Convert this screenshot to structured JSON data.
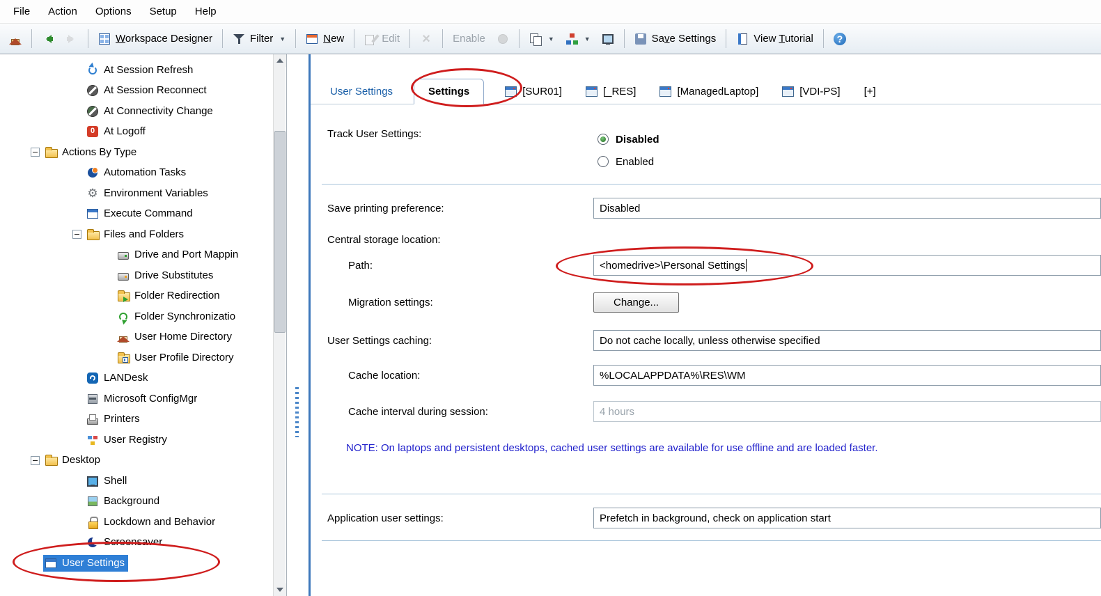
{
  "menu": {
    "items": [
      {
        "label": "File"
      },
      {
        "label": "Action"
      },
      {
        "label": "Options"
      },
      {
        "label": "Setup"
      },
      {
        "label": "Help"
      }
    ]
  },
  "toolbar": {
    "workspace_designer": {
      "pre": "",
      "accel": "W",
      "post": "orkspace Designer"
    },
    "filter_label": "Filter",
    "new": {
      "pre": "",
      "accel": "N",
      "post": "ew"
    },
    "edit_label": "Edit",
    "enable_label": "Enable",
    "save_settings": {
      "pre": "Sa",
      "accel": "v",
      "post": "e Settings"
    },
    "view_tutorial": {
      "pre": "View ",
      "accel": "T",
      "post": "utorial"
    }
  },
  "icons": {
    "toolbar": [
      "home-icon",
      "back-icon",
      "forward-icon",
      "workspace-designer-icon",
      "filter-icon",
      "new-icon",
      "edit-icon",
      "delete-icon",
      "enable-icon",
      "copy-icon",
      "org-chart-icon",
      "monitor-icon",
      "save-icon",
      "tutorial-book-icon",
      "help-icon"
    ],
    "tree_expander": "minus-box",
    "tab_icon": "window-thumbnail"
  },
  "tree": {
    "items": [
      {
        "label": "At Session Refresh",
        "icon": "session-refresh-icon"
      },
      {
        "label": "At Session Reconnect",
        "icon": "session-reconnect-icon"
      },
      {
        "label": "At Connectivity Change",
        "icon": "connectivity-change-icon"
      },
      {
        "label": "At Logoff",
        "icon": "logoff-icon"
      },
      {
        "label": "Actions By Type",
        "icon": "folder-icon"
      },
      {
        "label": "Automation Tasks",
        "icon": "automation-tasks-icon"
      },
      {
        "label": "Environment Variables",
        "icon": "environment-variables-icon"
      },
      {
        "label": "Execute Command",
        "icon": "execute-command-icon"
      },
      {
        "label": "Files and Folders",
        "icon": "folder-icon"
      },
      {
        "label": "Drive and Port Mappin",
        "icon": "drive-mapping-icon"
      },
      {
        "label": "Drive Substitutes",
        "icon": "drive-substitutes-icon"
      },
      {
        "label": "Folder Redirection",
        "icon": "folder-redirection-icon"
      },
      {
        "label": "Folder Synchronizatio",
        "icon": "folder-synchronization-icon"
      },
      {
        "label": "User Home Directory",
        "icon": "home-directory-icon"
      },
      {
        "label": "User Profile Directory",
        "icon": "profile-directory-icon"
      },
      {
        "label": "LANDesk",
        "icon": "landesk-icon"
      },
      {
        "label": "Microsoft ConfigMgr",
        "icon": "configmgr-icon"
      },
      {
        "label": "Printers",
        "icon": "printer-icon"
      },
      {
        "label": "User Registry",
        "icon": "registry-icon"
      },
      {
        "label": "Desktop",
        "icon": "folder-icon"
      },
      {
        "label": "Shell",
        "icon": "shell-icon"
      },
      {
        "label": "Background",
        "icon": "background-icon"
      },
      {
        "label": "Lockdown and Behavior",
        "icon": "lock-icon"
      },
      {
        "label": "Screensaver",
        "icon": "screensaver-icon"
      },
      {
        "label": "User Settings",
        "icon": "user-settings-icon",
        "selected": true
      }
    ]
  },
  "tabs": {
    "items": [
      {
        "label": "User Settings"
      },
      {
        "label": "Settings",
        "active": true
      },
      {
        "label": "[SUR01]"
      },
      {
        "label": "[_RES]"
      },
      {
        "label": "[ManagedLaptop]"
      },
      {
        "label": "[VDI-PS]"
      },
      {
        "label": "[+]"
      }
    ]
  },
  "form": {
    "track_user_settings": {
      "label": "Track User Settings:",
      "options": [
        {
          "label": "Disabled",
          "selected": true
        },
        {
          "label": "Enabled",
          "selected": false
        }
      ]
    },
    "save_printing_preference": {
      "label": "Save printing preference:",
      "value": "Disabled"
    },
    "central_storage_location_label": "Central storage location:",
    "path": {
      "label": "Path:",
      "value": "<homedrive>\\Personal Settings"
    },
    "migration_settings": {
      "label": "Migration settings:",
      "button_label": "Change..."
    },
    "user_settings_caching": {
      "label": "User Settings caching:",
      "value": "Do not cache locally, unless otherwise specified"
    },
    "cache_location": {
      "label": "Cache location:",
      "value": "%LOCALAPPDATA%\\RES\\WM"
    },
    "cache_interval": {
      "label": "Cache interval during session:",
      "value": "4 hours"
    },
    "note": "NOTE: On laptops and persistent desktops, cached user settings are available for use offline and are loaded faster.",
    "application_user_settings": {
      "label": "Application user settings:",
      "value": "Prefetch in background, check on application start"
    }
  },
  "colors": {
    "selection": "#2f7fd6",
    "annotation": "#cf1d1d",
    "note_text": "#2222cc",
    "divider": "#a9c4da",
    "panel_border": "#3c77bb"
  }
}
